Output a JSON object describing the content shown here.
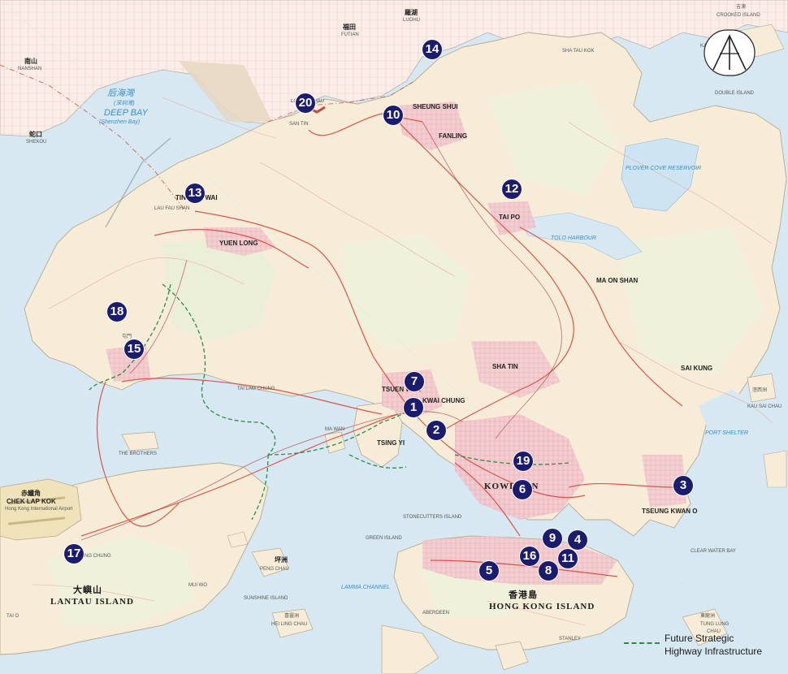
{
  "markers": [
    "1",
    "2",
    "3",
    "4",
    "5",
    "6",
    "7",
    "8",
    "9",
    "10",
    "11",
    "12",
    "13",
    "14",
    "15",
    "16",
    "17",
    "18",
    "19",
    "20"
  ],
  "legend": {
    "line1": "Future Strategic",
    "line2": "Highway Infrastructure"
  },
  "labels": {
    "nanshan": "南山",
    "nanshan_en": "NANSHAN",
    "futian": "福田",
    "futian_en": "FUTIAN",
    "luohu": "羅湖",
    "luohu_en": "LUOHU",
    "shekou": "蛇口",
    "shekou_en": "SHEKOU",
    "deep_bay_cn": "后海灣",
    "deep_bay_cn2": "(深圳灣)",
    "deep_bay_en": "DEEP BAY",
    "deep_bay_en2": "(Shenzhen Bay)",
    "crooked_island": "CROOKED ISLAND",
    "crooked_cn": "吉澳",
    "sheung_shui": "SHEUNG SHUI",
    "fanling": "FANLING",
    "yuen_long": "YUEN LONG",
    "tai_po": "TAI PO",
    "tsuen_wan": "TSUEN WAN",
    "kwai_chung": "KWAI CHUNG",
    "tsing_yi": "TSING YI",
    "kowloon": "KOWLOON",
    "chek_lap_kok_cn": "赤鱲角",
    "chek_lap_kok": "CHEK LAP KOK",
    "hk_airport": "Hong Kong International Airport",
    "tung_chung": "TUNG CHUNG",
    "lantau_cn": "大嶼山",
    "lantau_en": "LANTAU ISLAND",
    "hk_island_cn": "香港島",
    "hk_island_en": "HONG KONG ISLAND",
    "peng_chau_cn": "坪洲",
    "peng_chau": "PENG CHAU",
    "hei_ling_chau_cn": "喜靈洲",
    "hei_ling_chau": "HEI LING CHAU",
    "tseung_kwan_o": "TSEUNG KWAN O",
    "kau_sai_chau_cn": "滘西洲",
    "kau_sai_chau": "KAU SAI CHAU",
    "tung_lung_cn": "東龍洲",
    "tung_lung": "TUNG LUNG",
    "tung_lung2": "CHAU",
    "ma_on_shan": "MA ON SHAN",
    "tolo_harbour": "TOLO HARBOUR",
    "port_shelter": "PORT SHELTER",
    "tuen_mun_cn": "屯門",
    "tin_shui_wai": "TIN SHUI WAI",
    "sha_tin": "SHA TIN",
    "lau_fau_shan": "LAU FAU SHAN",
    "double_island": "DOUBLE ISLAND",
    "plover_cove": "PLOVER COVE RESERVOIR",
    "shenzhen_river": "SAN TIN",
    "lok_ma_chau": "LOK MA CHAU",
    "ma_wan": "MA WAN",
    "the_brothers": "THE BROTHERS",
    "sunshine_island": "SUNSHINE ISLAND",
    "green_island": "GREEN ISLAND",
    "lamma_channel": "LAMMA CHANNEL",
    "mui_wo": "MUI WO",
    "sai_kung": "SAI KUNG",
    "clear_water_bay": "CLEAR WATER BAY",
    "sha_tau_kok": "SHA TAU KOK",
    "kat_o": "KAT O",
    "stonecutters": "STONECUTTERS ISLAND",
    "aberdeen": "ABERDEEN",
    "stanley": "STANLEY",
    "tai_o": "TAI O",
    "tai_lam": "TAI LAM CHUNG"
  }
}
